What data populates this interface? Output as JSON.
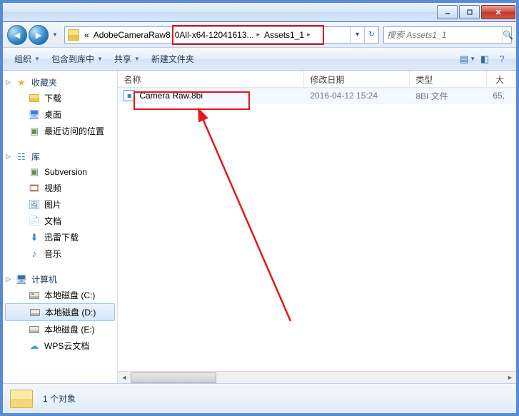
{
  "breadcrumb": {
    "prefix": "«",
    "seg1": "AdobeCameraRaw8",
    "seg2": "0All-x64-12041613...",
    "seg3": "Assets1_1"
  },
  "search": {
    "placeholder": "搜索 Assets1_1"
  },
  "toolbar": {
    "organize": "组织",
    "include": "包含到库中",
    "share": "共享",
    "newfolder": "新建文件夹"
  },
  "columns": {
    "name": "名称",
    "date": "修改日期",
    "type": "类型",
    "size": "大小"
  },
  "file": {
    "name": "Camera Raw.8bi",
    "date": "2016-04-12 15:24",
    "type": "8BI 文件",
    "size": "65,"
  },
  "sidebar": {
    "favorites": "收藏夹",
    "downloads": "下载",
    "desktop": "桌面",
    "recent": "最近访问的位置",
    "library": "库",
    "subversion": "Subversion",
    "video": "视频",
    "pictures": "图片",
    "documents": "文档",
    "thunder": "迅雷下载",
    "music": "音乐",
    "computer": "计算机",
    "diskC": "本地磁盘 (C:)",
    "diskD": "本地磁盘 (D:)",
    "diskE": "本地磁盘 (E:)",
    "wps": "WPS云文档"
  },
  "status": {
    "count": "1 个对象"
  }
}
